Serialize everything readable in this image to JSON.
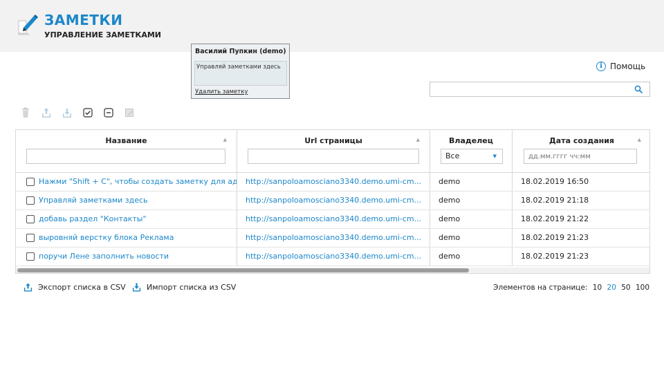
{
  "header": {
    "title": "ЗАМЕТКИ",
    "subtitle": "УПРАВЛЕНИЕ ЗАМЕТКАМИ",
    "logo_icon": "pencil-note-icon"
  },
  "popup": {
    "title": "Василий Пупкин (demo)",
    "body": "Управляй заметками здесь",
    "delete_label": "Удалить заметку"
  },
  "help": {
    "label": "Помощь",
    "icon": "info-icon"
  },
  "search": {
    "value": ""
  },
  "toolbar": [
    "trash-icon",
    "export-icon",
    "import-icon",
    "check-all-icon",
    "uncheck-icon",
    "edit-icon"
  ],
  "table": {
    "columns": [
      "Название",
      "Url страницы",
      "Владелец",
      "Дата создания"
    ],
    "filters": {
      "owner": "Все",
      "date_placeholder": "дд.мм.гггг чч:мм"
    },
    "rows": [
      {
        "name": "Нажми \"Shift + C\", чтобы создать заметку для ад",
        "url": "http://sanpoloamosciano3340.demo.umi-cm...",
        "owner": "demo",
        "date": "18.02.2019 16:50"
      },
      {
        "name": "Управляй заметками здесь",
        "url": "http://sanpoloamosciano3340.demo.umi-cm...",
        "owner": "demo",
        "date": "18.02.2019 21:18"
      },
      {
        "name": "добавь раздел \"Контакты\"",
        "url": "http://sanpoloamosciano3340.demo.umi-cm...",
        "owner": "demo",
        "date": "18.02.2019 21:22"
      },
      {
        "name": "выровняй верстку блока Реклама",
        "url": "http://sanpoloamosciano3340.demo.umi-cm...",
        "owner": "demo",
        "date": "18.02.2019 21:23"
      },
      {
        "name": "поручи Лене заполнить новости",
        "url": "http://sanpoloamosciano3340.demo.umi-cm...",
        "owner": "demo",
        "date": "18.02.2019 21:23"
      }
    ]
  },
  "footer": {
    "export_label": "Экспорт списка в CSV",
    "import_label": "Импорт списка из CSV",
    "page_size_label": "Элементов на странице:",
    "page_sizes": [
      "10",
      "20",
      "50",
      "100"
    ],
    "active_page_size": "20"
  },
  "colors": {
    "accent": "#1c87c9",
    "header_bg": "#f2f2f2"
  }
}
